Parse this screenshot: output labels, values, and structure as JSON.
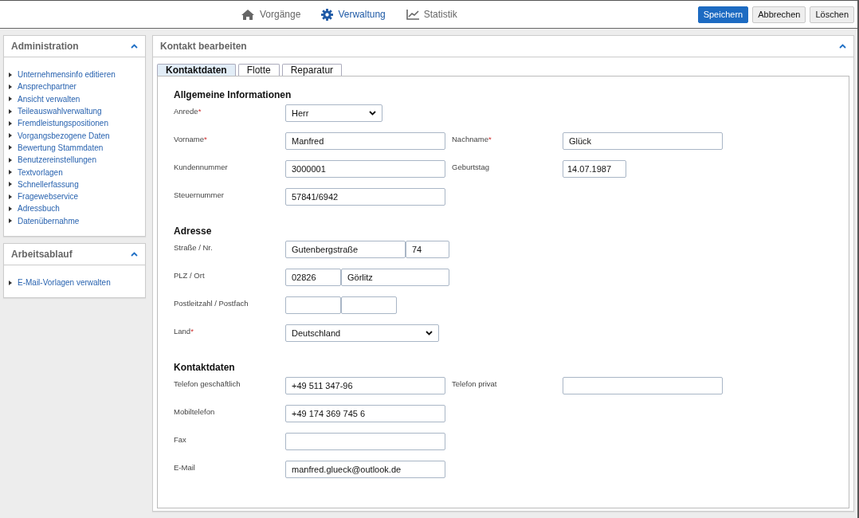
{
  "nav": [
    {
      "label": "Vorgänge",
      "kind": "home",
      "selected": false
    },
    {
      "label": "Verwaltung",
      "kind": "admin",
      "selected": true
    },
    {
      "label": "Statistik",
      "kind": "stats",
      "selected": false
    }
  ],
  "actions": [
    {
      "label": "Speichern",
      "kind": "primary"
    },
    {
      "label": "Abbrechen",
      "kind": "default"
    },
    {
      "label": "Löschen",
      "kind": "default"
    }
  ],
  "sidebar": [
    {
      "title": "Administration",
      "expanded": true,
      "items": [
        "Unternehmensinfo editieren",
        "Ansprechpartner",
        "Ansicht verwalten",
        "Teileauswahlverwaltung",
        "Fremdleistungspositionen",
        "Vorgangsbezogene Daten",
        "Bewertung Stammdaten",
        "Benutzereinstellungen",
        "Textvorlagen",
        "Schnellerfassung",
        "Fragewebservice",
        "Adressbuch",
        "Datenübernahme"
      ]
    },
    {
      "title": "Arbeitsablauf",
      "expanded": true,
      "items": [
        "E-Mail-Vorlagen verwalten"
      ]
    }
  ],
  "main": {
    "title": "Kontakt bearbeiten",
    "expanded": true,
    "tabs": [
      {
        "label": "Kontaktdaten",
        "selected": true
      },
      {
        "label": "Flotte",
        "selected": false
      },
      {
        "label": "Reparatur",
        "selected": false
      }
    ],
    "sections": [
      {
        "title": "Allgemeine Informationen",
        "rows": [
          [
            {
              "label": "Anrede",
              "marker": "*",
              "fields": [
                {
                  "kind": "select",
                  "value": "Herr"
                }
              ]
            }
          ],
          [
            {
              "label": "Vorname",
              "marker": "*",
              "fields": [
                {
                  "kind": "text",
                  "value": "Manfred"
                }
              ]
            },
            {
              "label": "Nachname",
              "marker": "*",
              "fields": [
                {
                  "kind": "text",
                  "value": "Glück"
                }
              ]
            }
          ],
          [
            {
              "label": "Kundennummer",
              "fields": [
                {
                  "kind": "text",
                  "value": "3000001"
                }
              ]
            },
            {
              "label": "Geburtstag",
              "fields": [
                {
                  "kind": "date",
                  "value": "14.07.1987"
                }
              ]
            }
          ],
          [
            {
              "label": "Steuernummer",
              "fields": [
                {
                  "kind": "text",
                  "value": "57841/6942"
                }
              ]
            }
          ]
        ]
      },
      {
        "title": "Adresse",
        "rows": [
          [
            {
              "label": "Straße / Nr.",
              "fields": [
                {
                  "kind": "street",
                  "value": "Gutenbergstraße"
                },
                {
                  "kind": "housenumber",
                  "value": "74"
                }
              ]
            }
          ],
          [
            {
              "label": "PLZ / Ort",
              "fields": [
                {
                  "kind": "zip",
                  "value": "02826"
                },
                {
                  "kind": "city",
                  "value": "Görlitz"
                }
              ]
            }
          ],
          [
            {
              "label": "Postleitzahl / Postfach",
              "fields": [
                {
                  "kind": "zip"
                },
                {
                  "kind": "pobox"
                }
              ]
            }
          ],
          [
            {
              "label": "Land",
              "marker": "*",
              "fields": [
                {
                  "kind": "country",
                  "value": "Deutschland"
                }
              ]
            }
          ]
        ]
      },
      {
        "title": "Kontaktdaten",
        "rows": [
          [
            {
              "label": "Telefon geschäftlich",
              "fields": [
                {
                  "kind": "text",
                  "value": "+49 511 347-96"
                }
              ]
            },
            {
              "label": "Telefon privat",
              "fields": [
                {
                  "kind": "text"
                }
              ]
            }
          ],
          [
            {
              "label": "Mobiltelefon",
              "fields": [
                {
                  "kind": "text",
                  "value": "+49 174 369 745 6"
                }
              ]
            }
          ],
          [
            {
              "label": "Fax",
              "fields": [
                {
                  "kind": "text"
                }
              ]
            }
          ],
          [
            {
              "label": "E-Mail",
              "fields": [
                {
                  "kind": "text",
                  "value": "manfred.glueck@outlook.de"
                }
              ]
            }
          ]
        ]
      }
    ]
  }
}
